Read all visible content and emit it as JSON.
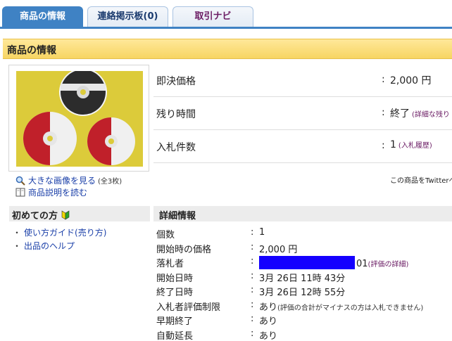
{
  "tabs": [
    {
      "label": "商品の情報"
    },
    {
      "label": "連絡掲示板(0)"
    },
    {
      "label": "取引ナビ"
    }
  ],
  "section_title": "商品の情報",
  "image_links": {
    "large_image": "大きな画像を見る",
    "count": "(全3枚)",
    "description": "商品説明を読む"
  },
  "price_rows": [
    {
      "label": "即決価格",
      "value": "2,000 円",
      "sub": ""
    },
    {
      "label": "残り時間",
      "value": "終了",
      "sub": "(詳細な残り"
    },
    {
      "label": "入札件数",
      "value": "1",
      "sub": "(入札履歴)"
    }
  ],
  "twitter_text": "この商品をTwitterへ",
  "first_time": {
    "title": "初めての方",
    "items": [
      "使い方ガイド(売り方)",
      "出品のヘルプ"
    ]
  },
  "detail": {
    "title": "詳細情報",
    "rows": [
      {
        "key": "個数",
        "value": "1",
        "note": ""
      },
      {
        "key": "開始時の価格",
        "value": "2,000 円",
        "note": ""
      },
      {
        "key": "落札者",
        "value": "01",
        "note": "(評価の詳細)"
      },
      {
        "key": "開始日時",
        "value": "3月 26日 11時 43分",
        "note": ""
      },
      {
        "key": "終了日時",
        "value": "3月 26日 12時 55分",
        "note": ""
      },
      {
        "key": "入札者評価制限",
        "value": "あり",
        "note": "(評価の合計がマイナスの方は入札できません)"
      },
      {
        "key": "早期終了",
        "value": "あり",
        "note": ""
      },
      {
        "key": "自動延長",
        "value": "あり",
        "note": ""
      }
    ]
  },
  "colors": {
    "tab_active": "#3f82c4",
    "header_yellow": "#f7d562",
    "link_blue": "#1a3fa8",
    "purple": "#6a1b63",
    "redaction": "#1400ff"
  }
}
